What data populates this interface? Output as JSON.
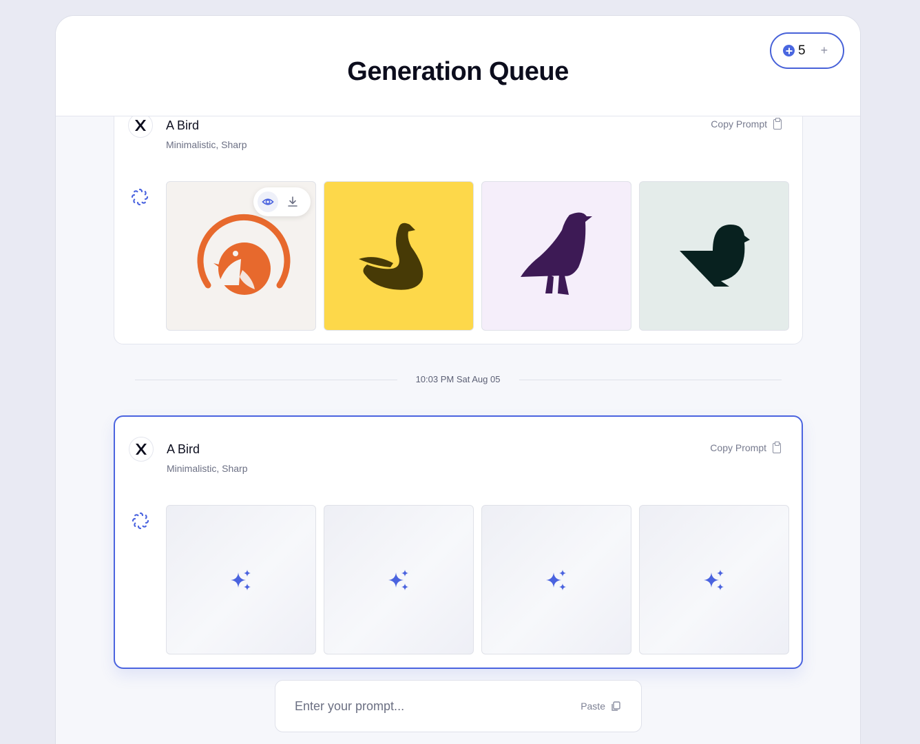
{
  "header": {
    "title": "Generation Queue",
    "credits": "5",
    "add_label": "+"
  },
  "queue": [
    {
      "title": "A Bird",
      "tags": "Minimalistic, Sharp",
      "copy_label": "Copy Prompt",
      "status": "complete",
      "images": [
        {
          "name": "orange-robin-logo",
          "bg": "#f5f2ef",
          "fg": "#e7692d"
        },
        {
          "name": "swan-logo",
          "bg": "#fdd84a",
          "fg": "#473a06"
        },
        {
          "name": "crow-logo",
          "bg": "#f5eefa",
          "fg": "#3d1a55"
        },
        {
          "name": "dove-logo",
          "bg": "#e4ecea",
          "fg": "#08211f"
        }
      ]
    },
    {
      "title": "A Bird",
      "tags": "Minimalistic, Sharp",
      "copy_label": "Copy Prompt",
      "status": "generating"
    }
  ],
  "timestamp": "10:03 PM  Sat Aug 05",
  "prompt_input": {
    "placeholder": "Enter your prompt...",
    "paste_label": "Paste"
  },
  "colors": {
    "accent": "#4a63df",
    "background": "#f6f7fb"
  }
}
